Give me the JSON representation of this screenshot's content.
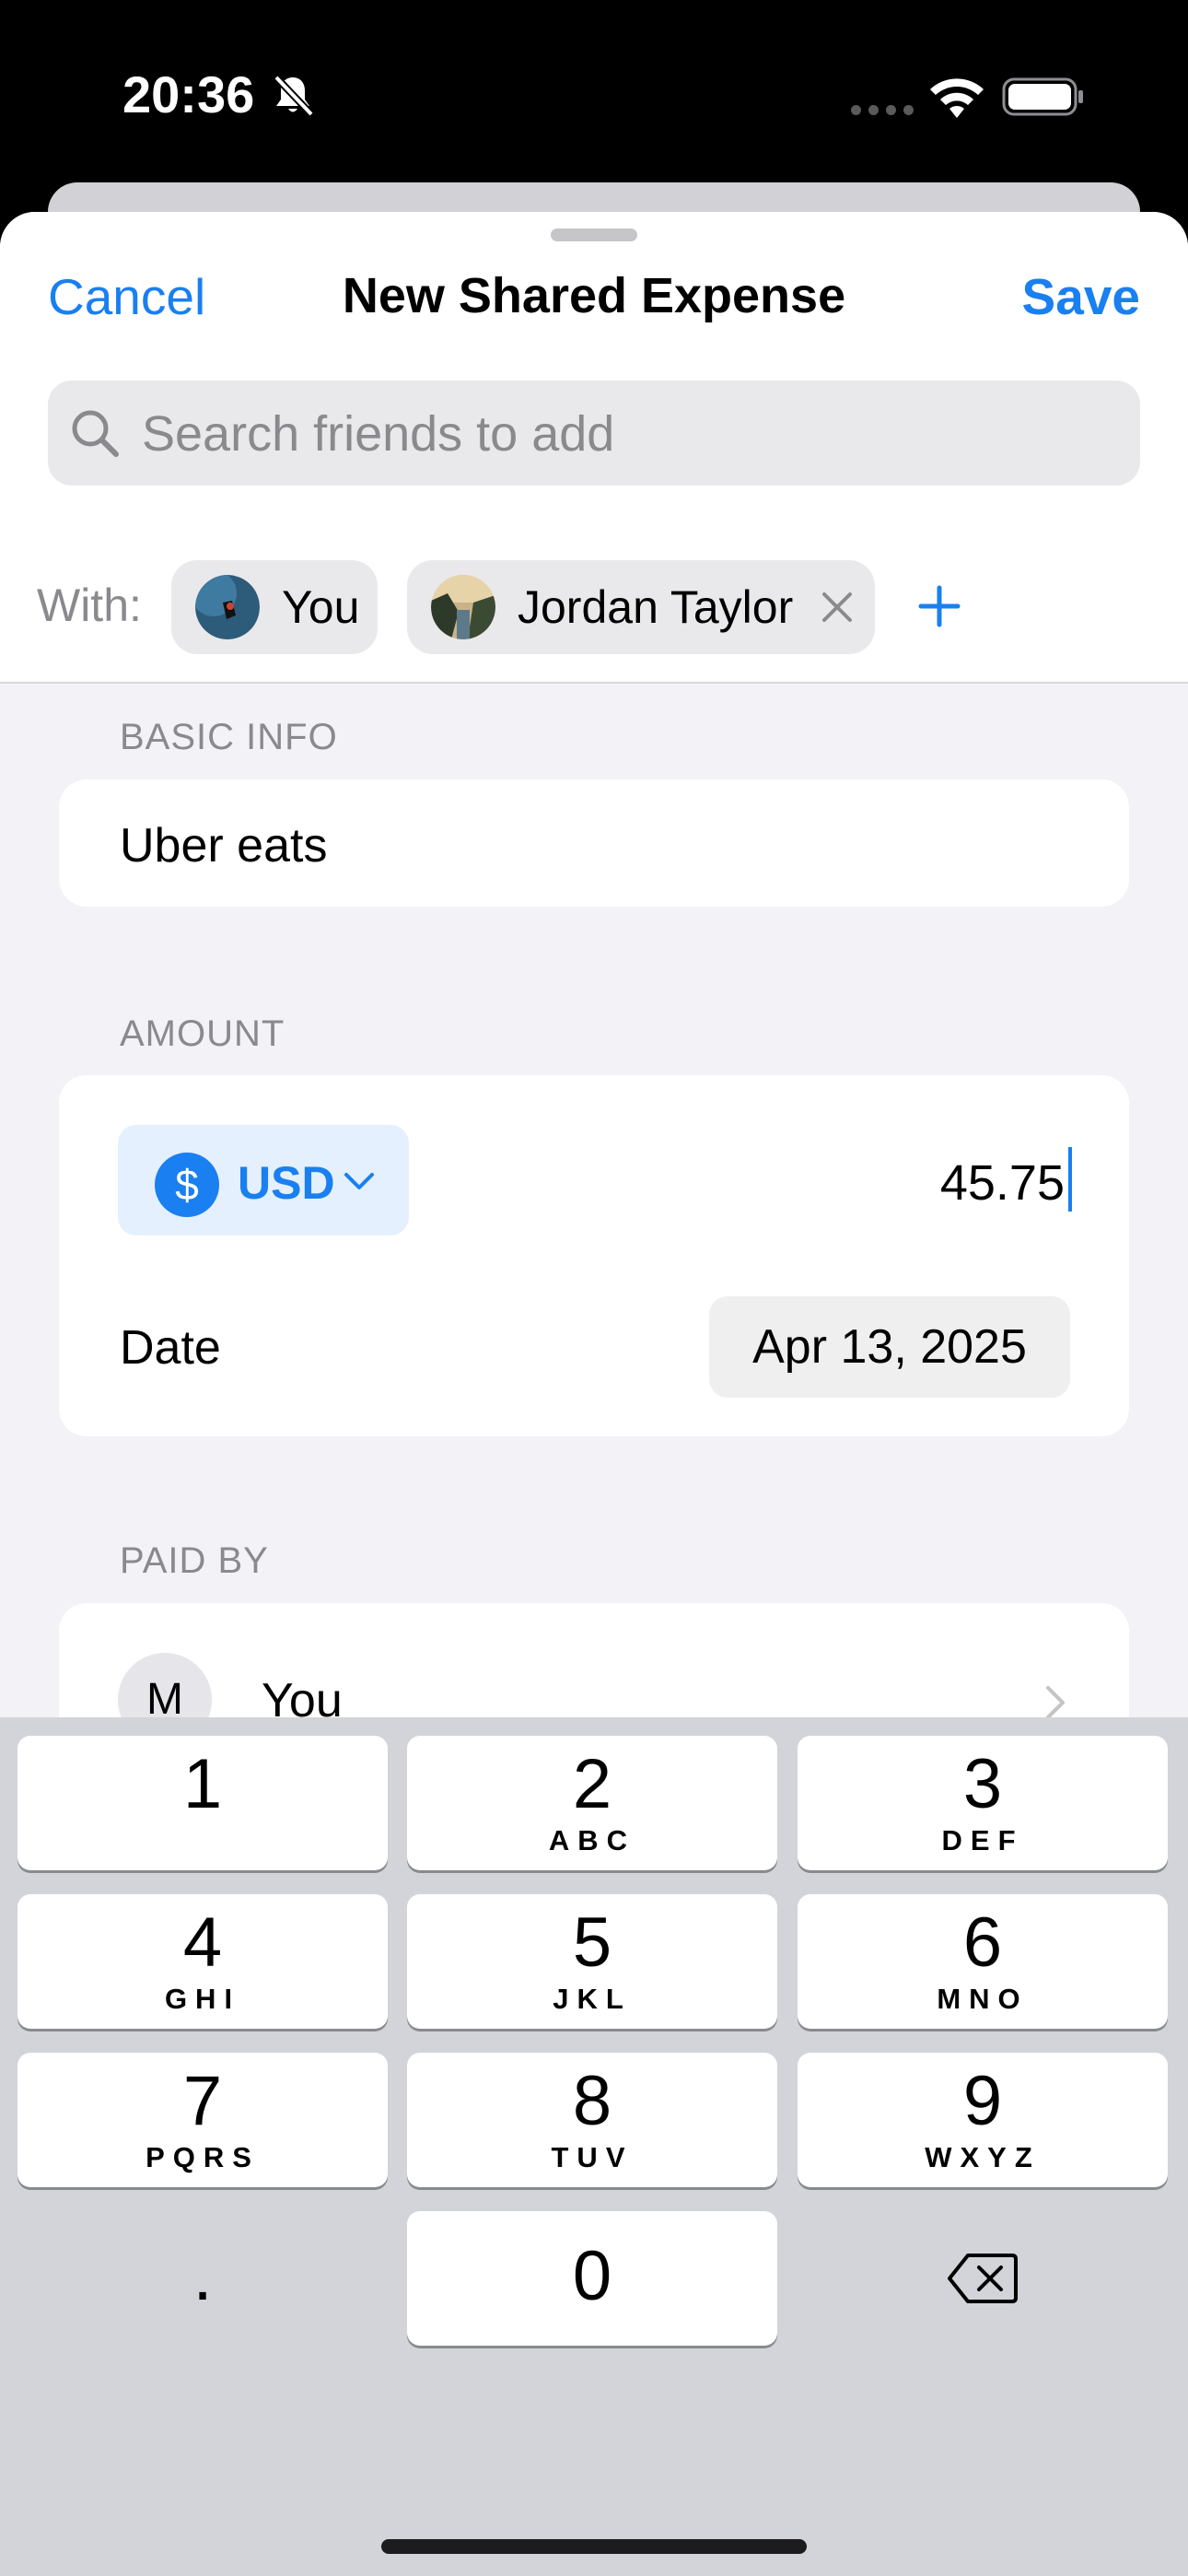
{
  "status_bar": {
    "time": "20:36",
    "icons": [
      "bell-slash-icon",
      "cellular-icon",
      "wifi-icon",
      "battery-icon"
    ]
  },
  "nav": {
    "cancel_label": "Cancel",
    "title": "New Shared Expense",
    "save_label": "Save"
  },
  "search": {
    "placeholder": "Search friends to add",
    "value": ""
  },
  "participants": {
    "label": "With:",
    "people": [
      {
        "name": "You",
        "removable": false
      },
      {
        "name": "Jordan Taylor",
        "removable": true
      }
    ]
  },
  "basic_info": {
    "section_label": "BASIC INFO",
    "title_value": "Uber eats"
  },
  "amount": {
    "section_label": "AMOUNT",
    "currency_symbol": "$",
    "currency_code": "USD",
    "value": "45.75",
    "date_label": "Date",
    "date_value": "Apr 13, 2025"
  },
  "paid_by": {
    "section_label": "PAID BY",
    "avatar_initial": "M",
    "name": "You"
  },
  "keypad": {
    "keys": [
      {
        "digit": "1",
        "letters": ""
      },
      {
        "digit": "2",
        "letters": "ABC"
      },
      {
        "digit": "3",
        "letters": "DEF"
      },
      {
        "digit": "4",
        "letters": "GHI"
      },
      {
        "digit": "5",
        "letters": "JKL"
      },
      {
        "digit": "6",
        "letters": "MNO"
      },
      {
        "digit": "7",
        "letters": "PQRS"
      },
      {
        "digit": "8",
        "letters": "TUV"
      },
      {
        "digit": "9",
        "letters": "WXYZ"
      },
      {
        "digit": ".",
        "letters": ""
      },
      {
        "digit": "0",
        "letters": ""
      }
    ],
    "delete_icon": "delete-backward-icon"
  },
  "colors": {
    "accent": "#1a7ff0",
    "background": "#f2f2f7",
    "keyboard": "#d2d4da"
  }
}
